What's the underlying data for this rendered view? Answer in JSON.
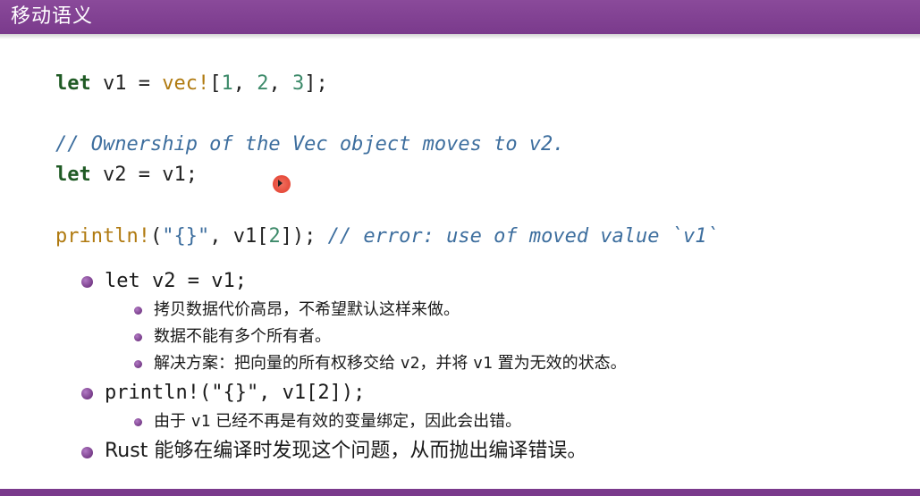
{
  "slide": {
    "title": "移动语义"
  },
  "code": {
    "line1": {
      "kw": "let",
      "rest1": " v1 = ",
      "macro": "vec!",
      "p1": "[",
      "n1": "1",
      "c1": ", ",
      "n2": "2",
      "c2": ", ",
      "n3": "3",
      "p2": "];"
    },
    "line2": {
      "comment": "// Ownership of the Vec object moves to v2."
    },
    "line3": {
      "kw": "let",
      "rest": " v2 = v1;"
    },
    "line4": {
      "macro": "println!",
      "p1": "(",
      "str": "\"{}\"",
      "mid": ", v1[",
      "n": "2",
      "end": "]); ",
      "comment": "// error: use of moved value `v1`"
    }
  },
  "bullets": [
    {
      "code": "let v2 = v1;",
      "subs": [
        {
          "text": "拷贝数据代价高昂，不希望默认这样来做。"
        },
        {
          "text": "数据不能有多个所有者。"
        },
        {
          "pre": "解决方案：把向量的所有权移交给 ",
          "c1": "v2",
          "mid": "，并将 ",
          "c2": "v1",
          "post": " 置为无效的状态。"
        }
      ]
    },
    {
      "code": "println!(\"{}\", v1[2]);",
      "subs": [
        {
          "pre": "由于 ",
          "c1": "v1",
          "post": " 已经不再是有效的变量绑定，因此会出错。"
        }
      ]
    },
    {
      "text": "Rust 能够在编译时发现这个问题，从而抛出编译错误。"
    }
  ],
  "colors": {
    "header": "#7a3a8c",
    "keyword": "#1f5a24",
    "macro": "#b07a10",
    "number": "#3d8a6a",
    "comment": "#3d6e9e"
  }
}
